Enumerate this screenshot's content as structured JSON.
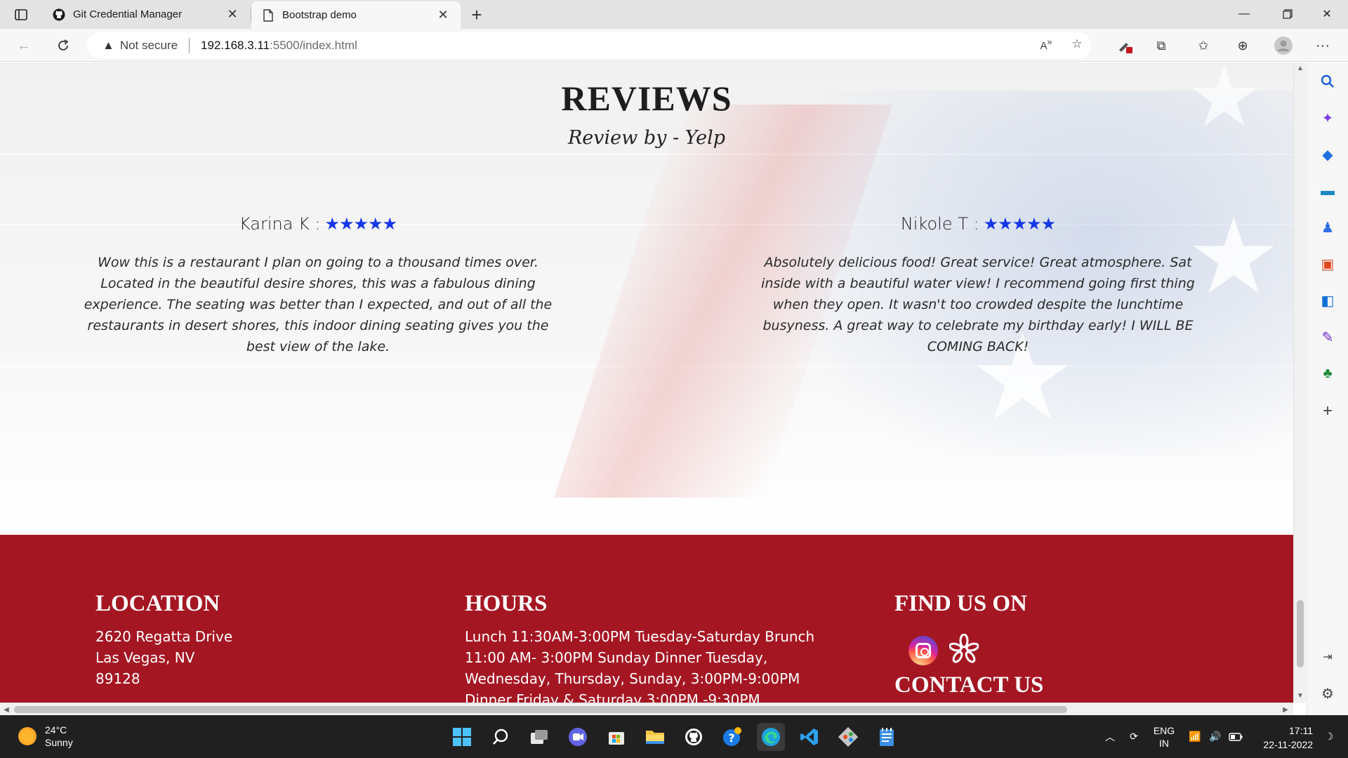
{
  "browser": {
    "tabs": [
      {
        "title": "Git Credential Manager",
        "icon": "github-icon",
        "active": false
      },
      {
        "title": "Bootstrap demo",
        "icon": "page-icon",
        "active": true
      }
    ],
    "address": {
      "security_label": "Not secure",
      "host": "192.168.3.11",
      "path": ":5500/index.html"
    }
  },
  "reviews": {
    "title": "REVIEWS",
    "subtitle": "Review by - Yelp",
    "items": [
      {
        "name": "Karina K :",
        "rating": 5,
        "stars": "★★★★★",
        "text": "Wow this is a restaurant I plan on going to a thousand times over. Located in the beautiful desire shores, this was a fabulous dining experience. The seating was better than I expected, and out of all the restaurants in desert shores, this indoor dining seating gives you the best view of the lake."
      },
      {
        "name": "Nikole T :",
        "rating": 5,
        "stars": "★★★★★",
        "text": "Absolutely delicious food! Great service! Great atmosphere. Sat inside with a beautiful water view! I recommend going first thing when they open. It wasn't too crowded despite the lunchtime busyness. A great way to celebrate my birthday early! I WILL BE COMING BACK!"
      }
    ]
  },
  "footer": {
    "location": {
      "heading": "LOCATION",
      "lines": [
        "2620 Regatta Drive",
        "Las Vegas, NV",
        "89128"
      ]
    },
    "hours": {
      "heading": "HOURS",
      "lines": [
        "Lunch 11:30AM-3:00PM Tuesday-Saturday Brunch",
        "11:00 AM- 3:00PM Sunday Dinner Tuesday,",
        "Wednesday, Thursday, Sunday, 3:00PM-9:00PM",
        "Dinner Friday & Saturday 3:00PM -9:30PM"
      ]
    },
    "find_us": {
      "heading": "FIND US ON",
      "links": [
        "instagram-icon",
        "yelp-icon"
      ]
    },
    "contact": {
      "heading": "CONTACT US"
    }
  },
  "taskbar": {
    "weather_temp": "24°C",
    "weather_desc": "Sunny",
    "lang_top": "ENG",
    "lang_bottom": "IN",
    "time": "17:11",
    "date": "22-11-2022"
  },
  "colors": {
    "footer_bg": "#a51623",
    "star_color": "#1636e8",
    "taskbar_bg": "#202020"
  }
}
